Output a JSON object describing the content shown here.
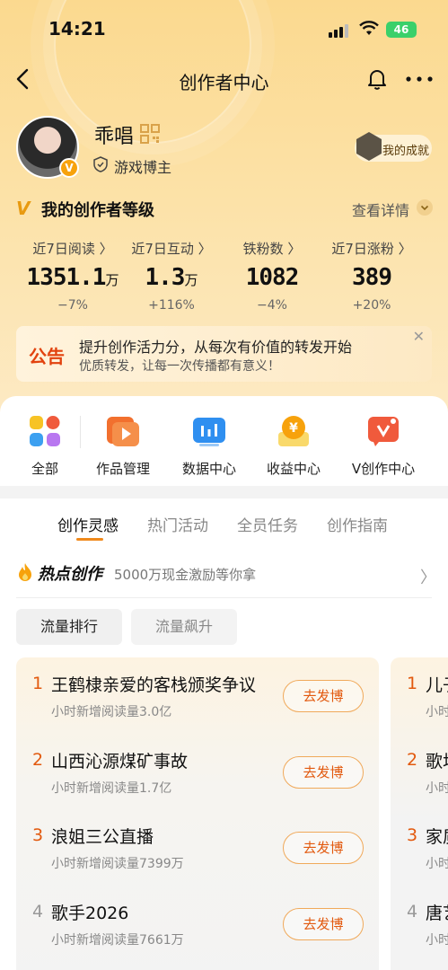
{
  "status_bar": {
    "time": "14:21",
    "battery": "46"
  },
  "nav": {
    "title": "创作者中心"
  },
  "profile": {
    "username": "乖唱",
    "tag": "游戏博主",
    "achievement": "我的成就"
  },
  "level": {
    "title": "我的创作者等级",
    "detail": "查看详情"
  },
  "stats": [
    {
      "label": "近7日阅读 〉",
      "value": "1351.1",
      "unit": "万",
      "change": "−7%"
    },
    {
      "label": "近7日互动 〉",
      "value": "1.3",
      "unit": "万",
      "change": "+116%"
    },
    {
      "label": "铁粉数 〉",
      "value": "1082",
      "unit": "",
      "change": "−4%"
    },
    {
      "label": "近7日涨粉 〉",
      "value": "389",
      "unit": "",
      "change": "+20%"
    }
  ],
  "notice": {
    "tag": "公告",
    "line1": "提升创作活力分，从每次有价值的转发开始",
    "line2": "优质转发，让每一次传播都有意义！"
  },
  "tools": [
    {
      "label": "全部",
      "icon": "grid-icon"
    },
    {
      "label": "作品管理",
      "icon": "play-icon"
    },
    {
      "label": "数据中心",
      "icon": "chart-icon"
    },
    {
      "label": "收益中心",
      "icon": "yen-icon"
    },
    {
      "label": "V创作中心",
      "icon": "v-create-icon"
    }
  ],
  "tabs": [
    "创作灵感",
    "热门活动",
    "全员任务",
    "创作指南"
  ],
  "hot": {
    "title": "热点创作",
    "subtitle": "5000万现金激励等你拿"
  },
  "filters": [
    "流量排行",
    "流量飙升"
  ],
  "list": [
    {
      "rank": "1",
      "title": "王鹤棣亲爱的客栈颁奖争议",
      "sub": "小时新增阅读量3.0亿",
      "button": "去发博"
    },
    {
      "rank": "2",
      "title": "山西沁源煤矿事故",
      "sub": "小时新增阅读量1.7亿",
      "button": "去发博"
    },
    {
      "rank": "3",
      "title": "浪姐三公直播",
      "sub": "小时新增阅读量7399万",
      "button": "去发博"
    },
    {
      "rank": "4",
      "title": "歌手2026",
      "sub": "小时新增阅读量7661万",
      "button": "去发博"
    }
  ],
  "list2": [
    {
      "rank": "1",
      "title": "儿子",
      "sub": "小时"
    },
    {
      "rank": "2",
      "title": "歌圳",
      "sub": "小时"
    },
    {
      "rank": "3",
      "title": "家质",
      "sub": "小时"
    },
    {
      "rank": "4",
      "title": "唐艺",
      "sub": "小时"
    }
  ]
}
